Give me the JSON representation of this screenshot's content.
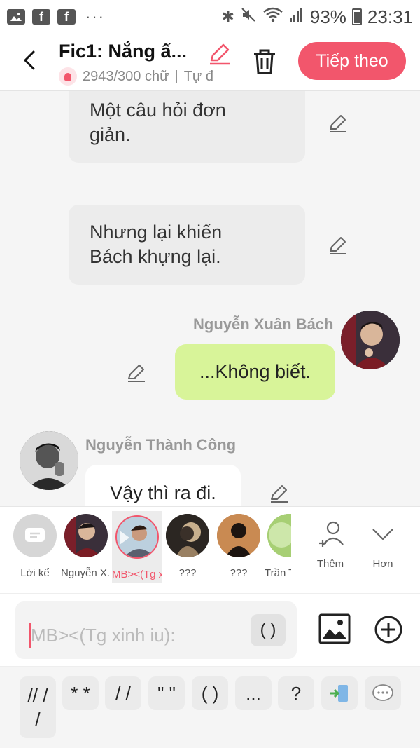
{
  "status_bar": {
    "battery": "93%",
    "time": "23:31",
    "dots": "···"
  },
  "header": {
    "title": "Fic1: Nắng ấ...",
    "word_count": "2943/300 chữ",
    "separator": "|",
    "autosave": "Tự đ",
    "next_label": "Tiếp theo"
  },
  "messages": [
    {
      "type": "narration",
      "text_line1": "Một câu hỏi đơn",
      "text_line2": "giản."
    },
    {
      "type": "narration",
      "text_line1": "Nhưng lại khiến",
      "text_line2": "Bách khựng lại."
    },
    {
      "type": "outgoing",
      "sender": "Nguyễn Xuân Bách",
      "text": "...Không biết."
    },
    {
      "type": "incoming",
      "sender": "Nguyễn Thành Công",
      "text": "Vậy thì ra đi."
    }
  ],
  "characters": [
    {
      "label": "Lời kể"
    },
    {
      "label": "Nguyễn X..."
    },
    {
      "label": "MB><(Tg x..."
    },
    {
      "label": "???"
    },
    {
      "label": "???"
    },
    {
      "label": "Trần T"
    }
  ],
  "actions": {
    "add_label": "Thêm",
    "more_label": "Hơn"
  },
  "composer": {
    "speaker_placeholder": "MB><(Tg xinh iu):",
    "paren_label": "( )"
  },
  "punctuation_keys": [
    {
      "label": "// /",
      "line2": "/"
    },
    {
      "label": "* *"
    },
    {
      "label": "/ /"
    },
    {
      "label": "\" \""
    },
    {
      "label": "( )"
    },
    {
      "label": "..."
    },
    {
      "label": "?"
    }
  ]
}
